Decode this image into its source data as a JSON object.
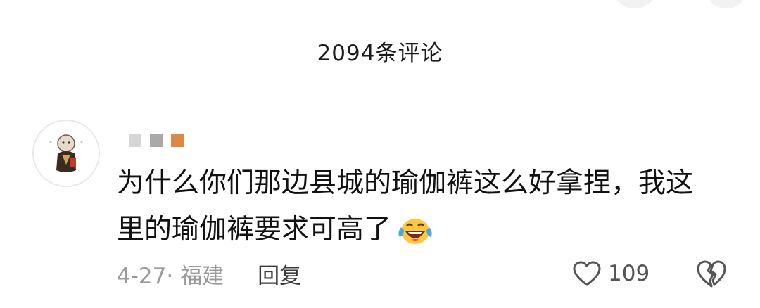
{
  "header": {
    "comment_count": "2094条评论"
  },
  "comment": {
    "username_blocks": [
      "#d6d6d6",
      "#a9a9a9",
      "#d98a46"
    ],
    "text_line1": "为什么你们那边县城的瑜伽裤这么好拿捏，我这",
    "text_line2": "里的瑜伽裤要求可高了",
    "emoji": "laughing-with-tears",
    "date_location": "4-27· 福建",
    "reply_label": "回复",
    "like_count": "109"
  },
  "icons": {
    "like": "heart-outline-icon",
    "dislike": "broken-heart-icon"
  }
}
